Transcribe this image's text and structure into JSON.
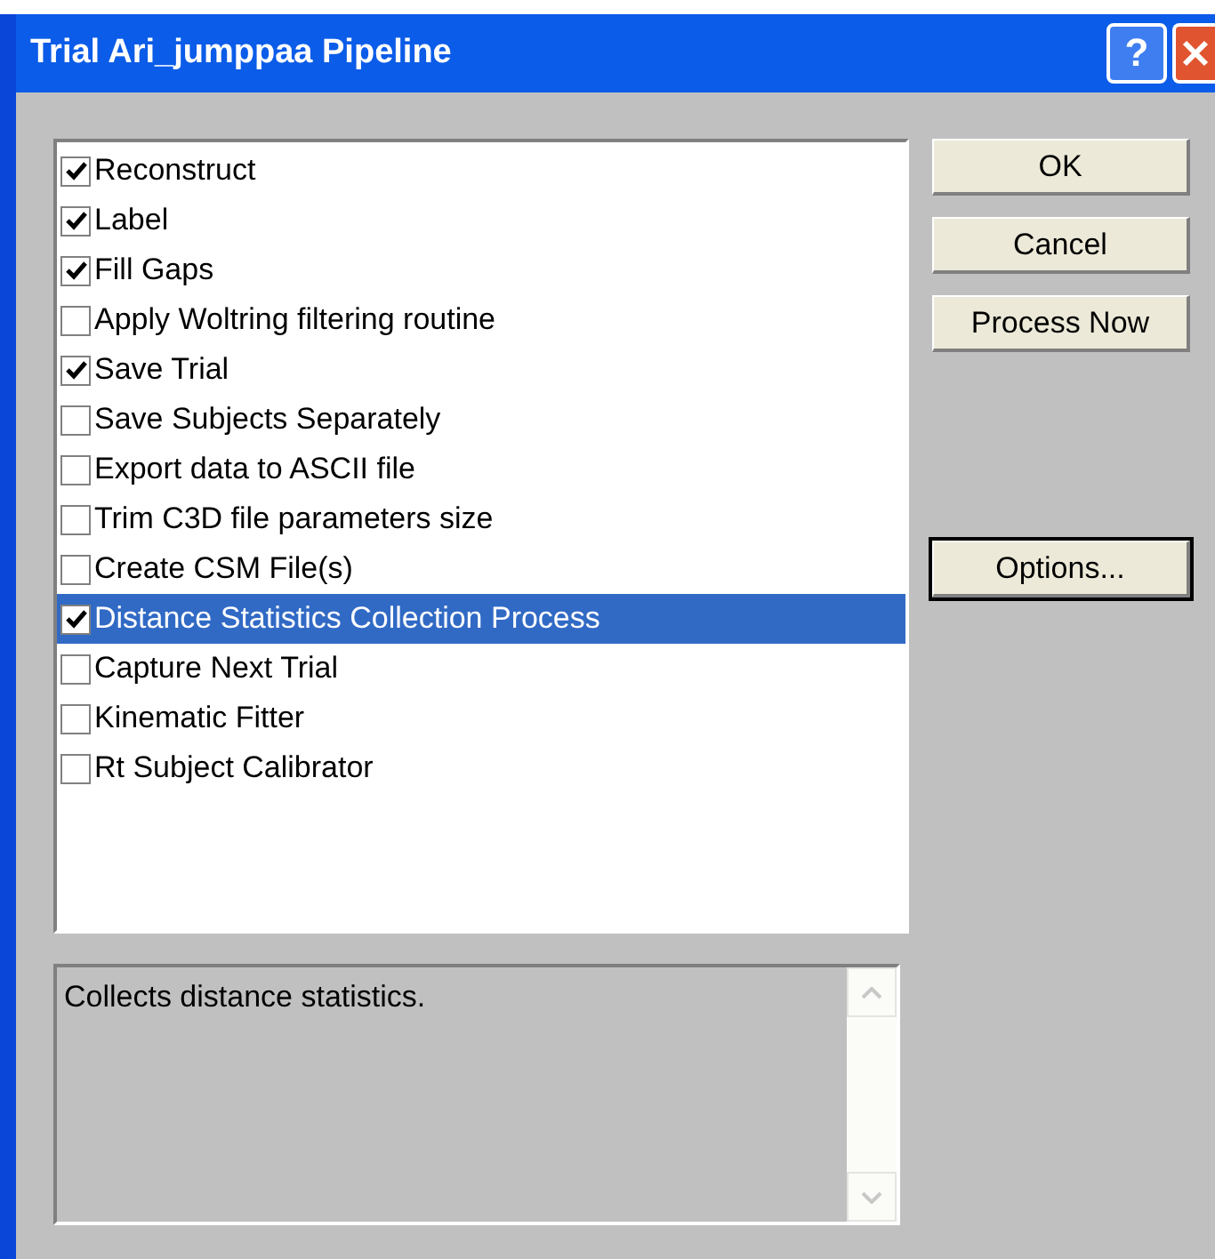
{
  "window": {
    "title": "Trial Ari_jumppaa Pipeline"
  },
  "title_buttons": [
    {
      "kind": "help",
      "label": "?"
    },
    {
      "kind": "close"
    }
  ],
  "pipeline": [
    {
      "label": "Reconstruct",
      "checked": true,
      "selected": false
    },
    {
      "label": "Label",
      "checked": true,
      "selected": false
    },
    {
      "label": "Fill Gaps",
      "checked": true,
      "selected": false
    },
    {
      "label": "Apply Woltring filtering routine",
      "checked": false,
      "selected": false
    },
    {
      "label": "Save Trial",
      "checked": true,
      "selected": false
    },
    {
      "label": "Save Subjects Separately",
      "checked": false,
      "selected": false
    },
    {
      "label": "Export data to ASCII file",
      "checked": false,
      "selected": false
    },
    {
      "label": "Trim C3D file parameters size",
      "checked": false,
      "selected": false
    },
    {
      "label": "Create CSM File(s)",
      "checked": false,
      "selected": false
    },
    {
      "label": "Distance Statistics Collection Process",
      "checked": true,
      "selected": true
    },
    {
      "label": "Capture Next Trial",
      "checked": false,
      "selected": false
    },
    {
      "label": "Kinematic Fitter",
      "checked": false,
      "selected": false
    },
    {
      "label": "Rt Subject Calibrator",
      "checked": false,
      "selected": false
    }
  ],
  "buttons": [
    {
      "label": "OK",
      "focused": false
    },
    {
      "label": "Cancel",
      "focused": false
    },
    {
      "label": "Process Now",
      "focused": false
    }
  ],
  "options_button": {
    "label": "Options...",
    "focused": true
  },
  "description": "Collects distance statistics."
}
